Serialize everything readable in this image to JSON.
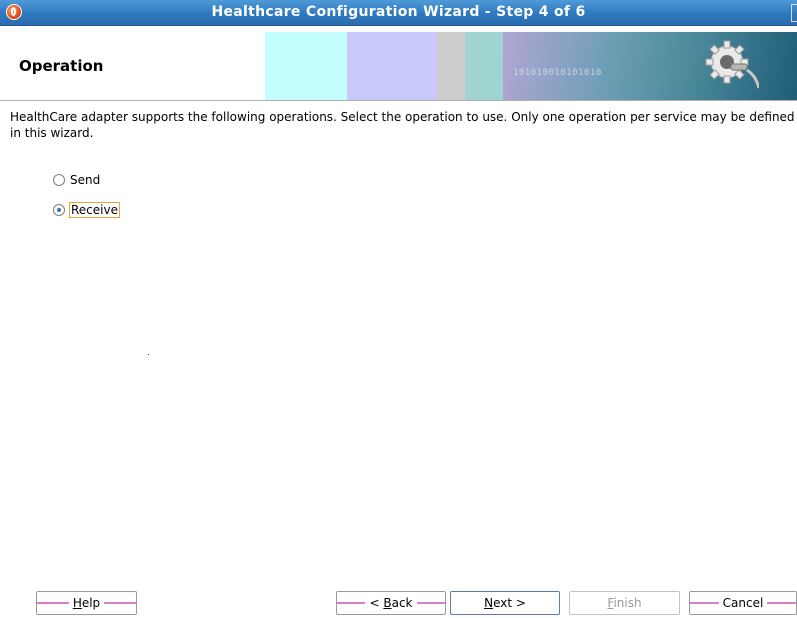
{
  "window": {
    "title": "Healthcare Configuration Wizard - Step 4 of 6"
  },
  "header": {
    "page_title": "Operation",
    "banner_text": "101010010101010"
  },
  "content": {
    "description": "HealthCare adapter supports the following operations.  Select the operation to use.  Only one operation per service may be defined in this wizard.",
    "operations": [
      {
        "label": "Send",
        "selected": false
      },
      {
        "label": "Receive",
        "selected": true
      }
    ]
  },
  "buttons": {
    "help": {
      "mnemonic": "H",
      "rest": "elp"
    },
    "back": {
      "prefix": "< ",
      "mnemonic": "B",
      "rest": "ack"
    },
    "next": {
      "mnemonic": "N",
      "rest": "ext >"
    },
    "finish": {
      "mnemonic": "F",
      "rest": "inish",
      "enabled": false
    },
    "cancel": {
      "label": "Cancel"
    }
  },
  "colors": {
    "titlebar": "#2e78be",
    "focus_outline": "#e8a33a",
    "button_stripe": "#d77ec8"
  }
}
